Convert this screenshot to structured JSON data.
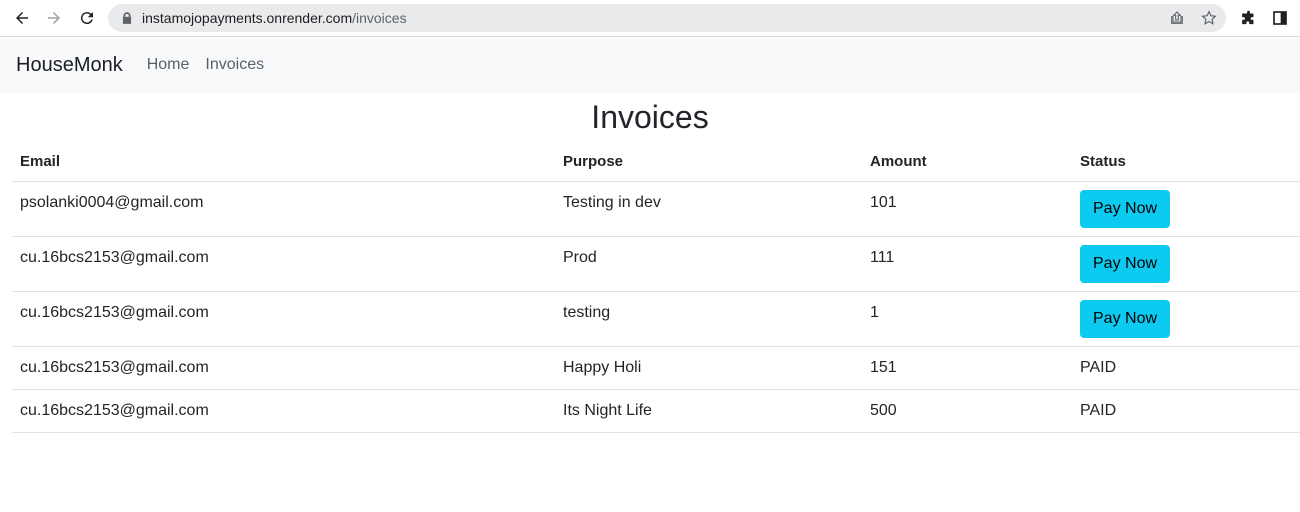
{
  "browser": {
    "url_host": "instamojopayments.onrender.com",
    "url_path": "/invoices"
  },
  "navbar": {
    "brand": "HouseMonk",
    "links": [
      "Home",
      "Invoices"
    ]
  },
  "page": {
    "title": "Invoices"
  },
  "table": {
    "headers": [
      "Email",
      "Purpose",
      "Amount",
      "Status"
    ],
    "rows": [
      {
        "email": "psolanki0004@gmail.com",
        "purpose": "Testing in dev",
        "amount": "101",
        "status": "Pay Now",
        "paid": false
      },
      {
        "email": "cu.16bcs2153@gmail.com",
        "purpose": "Prod",
        "amount": "111",
        "status": "Pay Now",
        "paid": false
      },
      {
        "email": "cu.16bcs2153@gmail.com",
        "purpose": "testing",
        "amount": "1",
        "status": "Pay Now",
        "paid": false
      },
      {
        "email": "cu.16bcs2153@gmail.com",
        "purpose": "Happy Holi",
        "amount": "151",
        "status": "PAID",
        "paid": true
      },
      {
        "email": "cu.16bcs2153@gmail.com",
        "purpose": "Its Night Life",
        "amount": "500",
        "status": "PAID",
        "paid": true
      }
    ]
  },
  "colors": {
    "pay_button": "#0dcaf0",
    "navbar_bg": "#f8f9fa"
  }
}
